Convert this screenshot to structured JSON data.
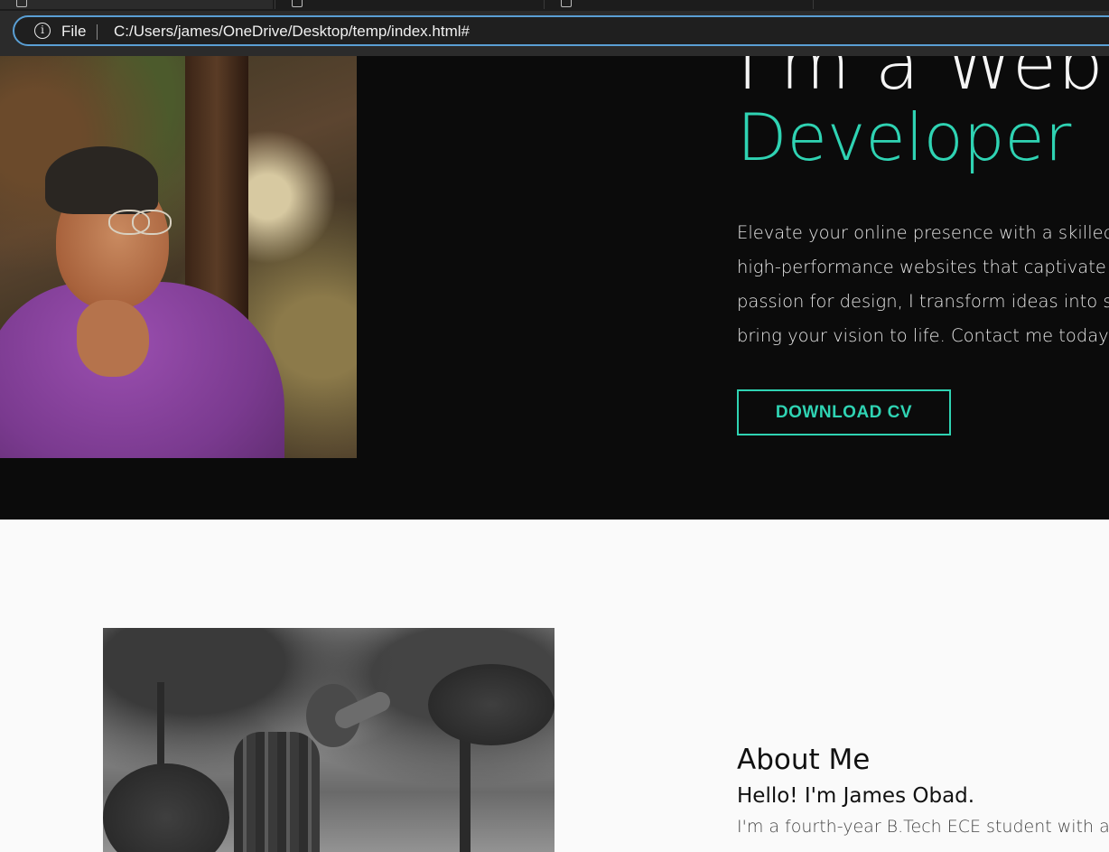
{
  "browser": {
    "address_scheme": "File",
    "address_url": "C:/Users/james/OneDrive/Desktop/temp/index.html#"
  },
  "hero": {
    "title_partial": "I'm a Web",
    "role": "Developer",
    "description_lines": [
      "Elevate your online presence with a skilled",
      "high-performance websites that captivate",
      "passion for design, I transform ideas into s",
      "bring your vision to life. Contact me today!"
    ],
    "cv_button": "DOWNLOAD CV",
    "accent_color": "#2fd3b3",
    "background_color": "#0b0b0b"
  },
  "about": {
    "heading": "About Me",
    "greeting": "Hello! I'm James Obad.",
    "text": "I'm a fourth-year B.Tech ECE student with a"
  }
}
